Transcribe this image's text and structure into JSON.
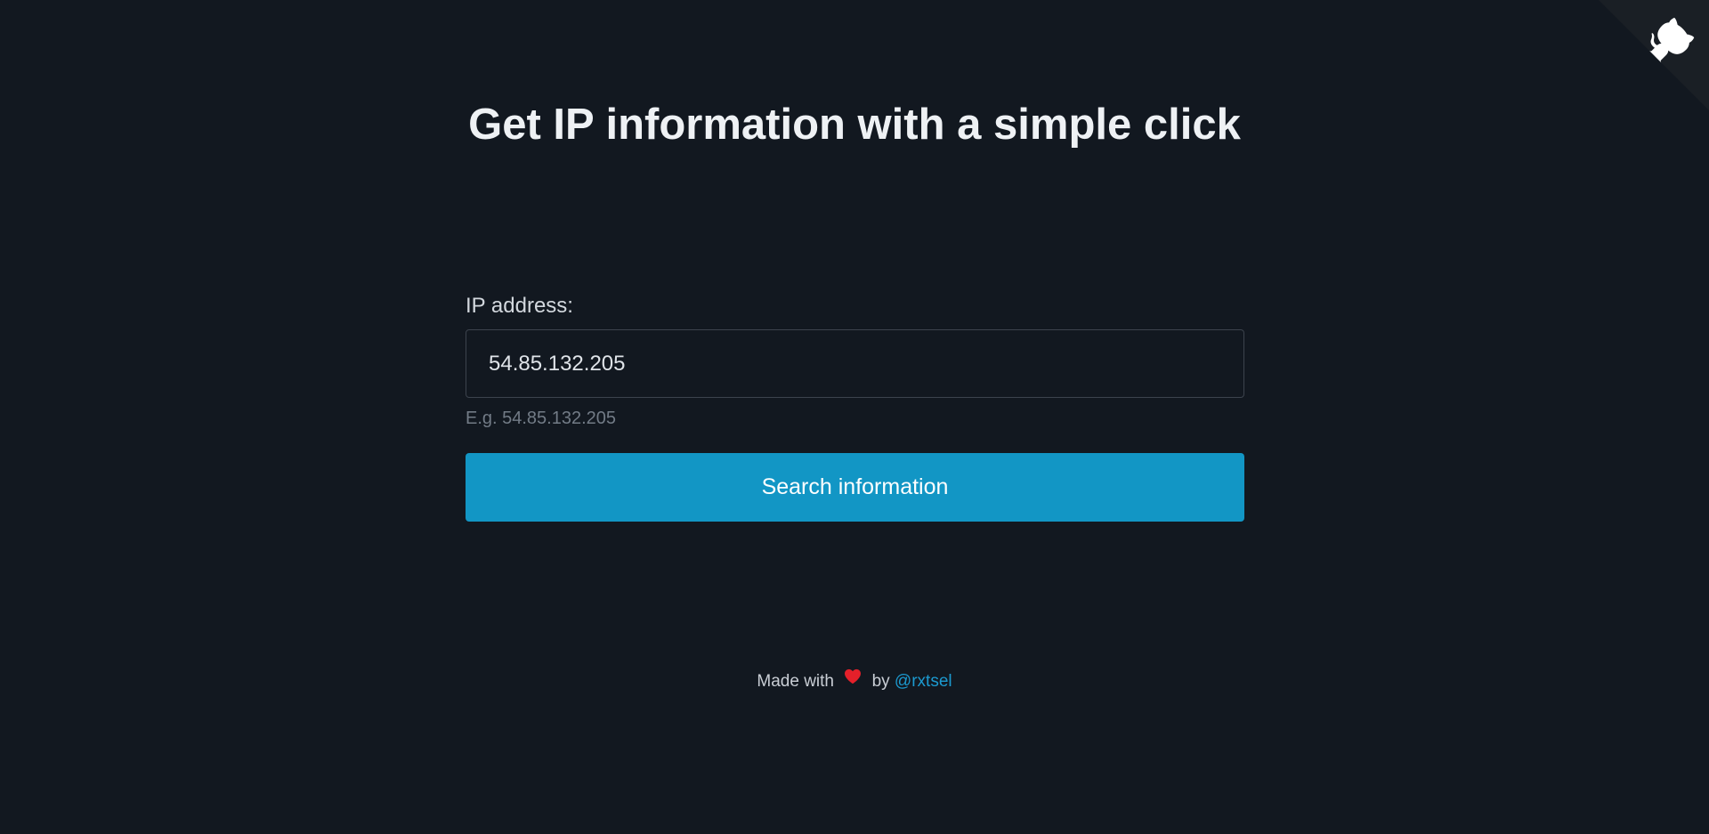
{
  "github_corner": {
    "icon": "octocat-icon",
    "corner_color": "#1a1f25",
    "cat_color": "#ffffff"
  },
  "header": {
    "title": "Get IP information with a simple click"
  },
  "form": {
    "label": "IP address:",
    "ip_value": "54.85.132.205",
    "hint": "E.g. 54.85.132.205",
    "search_label": "Search information",
    "button_color": "#1296c5"
  },
  "footer": {
    "made_with": "Made with",
    "heart_icon": "heart-icon",
    "by": "by",
    "author": "@rxtsel"
  },
  "colors": {
    "background": "#121820",
    "link": "#1c9ad0",
    "heart": "#e4202a"
  }
}
